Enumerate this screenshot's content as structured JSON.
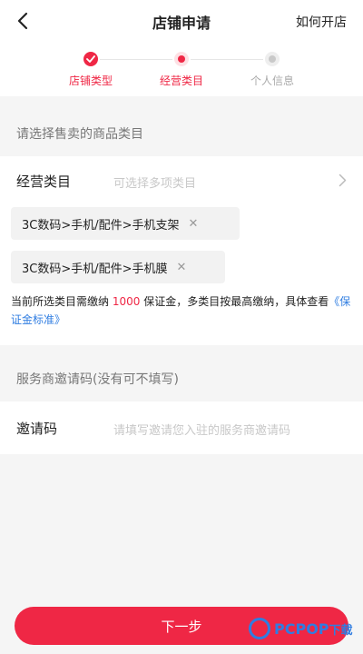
{
  "nav": {
    "title": "店铺申请",
    "help": "如何开店"
  },
  "steps": [
    {
      "label": "店铺类型",
      "state": "done"
    },
    {
      "label": "经营类目",
      "state": "active"
    },
    {
      "label": "个人信息",
      "state": "pending"
    }
  ],
  "category_section": {
    "heading": "请选择售卖的商品类目",
    "row_label": "经营类目",
    "row_placeholder": "可选择多项类目",
    "tags": [
      "3C数码>手机/配件>手机支架",
      "3C数码>手机/配件>手机膜"
    ],
    "note_prefix": "当前所选类目需缴纳 ",
    "note_amount": "1000",
    "note_suffix": " 保证金，多类目按最高缴纳，具体查看",
    "note_link": "《保证金标准》"
  },
  "invite_section": {
    "heading": "服务商邀请码(没有可不填写)",
    "row_label": "邀请码",
    "placeholder": "请填写邀请您入驻的服务商邀请码"
  },
  "footer": {
    "next_label": "下一步"
  },
  "watermark": {
    "text": "PCPOP",
    "suffix": "下载"
  },
  "colors": {
    "accent": "#ef2745",
    "link": "#2f7de1"
  }
}
